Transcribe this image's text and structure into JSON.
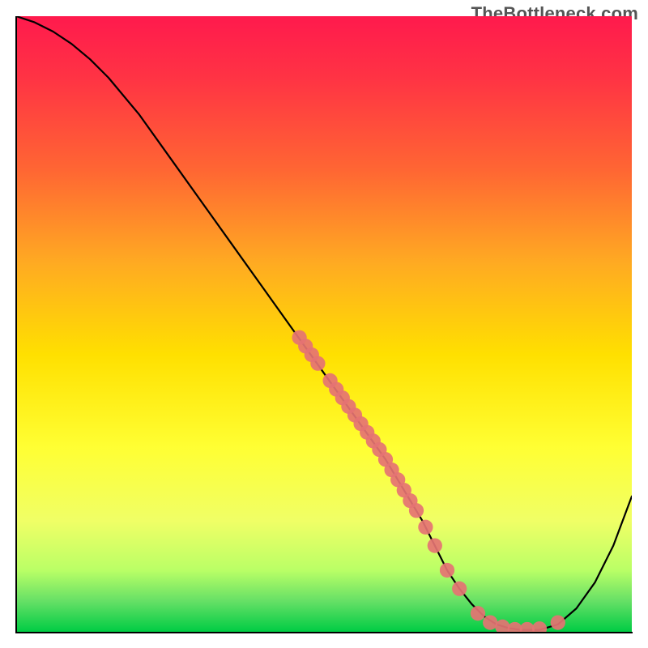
{
  "watermark": "TheBottleneck.com",
  "chart_data": {
    "type": "line",
    "title": "",
    "xlabel": "",
    "ylabel": "",
    "xlim": [
      0,
      100
    ],
    "ylim": [
      0,
      100
    ],
    "grid": false,
    "series": [
      {
        "name": "bottleneck-curve",
        "x": [
          0,
          3,
          6,
          9,
          12,
          15,
          20,
          25,
          30,
          35,
          40,
          45,
          50,
          55,
          60,
          63,
          66,
          68,
          70,
          72,
          74,
          76,
          78,
          80,
          82,
          85,
          88,
          91,
          94,
          97,
          100
        ],
        "y": [
          100,
          99,
          97.5,
          95.5,
          93,
          90,
          84,
          77,
          70,
          63,
          56,
          49,
          42,
          35,
          28,
          23,
          18,
          14,
          10,
          7,
          4.5,
          2.5,
          1.2,
          0.6,
          0.3,
          0.3,
          1.2,
          3.8,
          8,
          14,
          22
        ]
      }
    ],
    "scatter_points": [
      {
        "name": "marker-cluster",
        "x": 46,
        "y": 47.8,
        "r": 1.2
      },
      {
        "name": "marker-cluster",
        "x": 47,
        "y": 46.4,
        "r": 1.2
      },
      {
        "name": "marker-cluster",
        "x": 48,
        "y": 45.0,
        "r": 1.2
      },
      {
        "name": "marker-cluster",
        "x": 49,
        "y": 43.6,
        "r": 1.2
      },
      {
        "name": "marker-cluster",
        "x": 51,
        "y": 40.8,
        "r": 1.2
      },
      {
        "name": "marker-cluster",
        "x": 52,
        "y": 39.4,
        "r": 1.2
      },
      {
        "name": "marker-cluster",
        "x": 53,
        "y": 38.0,
        "r": 1.2
      },
      {
        "name": "marker-cluster",
        "x": 54,
        "y": 36.6,
        "r": 1.2
      },
      {
        "name": "marker-cluster",
        "x": 55,
        "y": 35.2,
        "r": 1.2
      },
      {
        "name": "marker-cluster",
        "x": 56,
        "y": 33.8,
        "r": 1.2
      },
      {
        "name": "marker-cluster",
        "x": 57,
        "y": 32.4,
        "r": 1.2
      },
      {
        "name": "marker-cluster",
        "x": 58,
        "y": 31.0,
        "r": 1.2
      },
      {
        "name": "marker-cluster",
        "x": 59,
        "y": 29.6,
        "r": 1.2
      },
      {
        "name": "marker-cluster",
        "x": 60,
        "y": 28.0,
        "r": 1.2
      },
      {
        "name": "marker-cluster",
        "x": 61,
        "y": 26.3,
        "r": 1.2
      },
      {
        "name": "marker-cluster",
        "x": 62,
        "y": 24.7,
        "r": 1.2
      },
      {
        "name": "marker-cluster",
        "x": 63,
        "y": 23.0,
        "r": 1.2
      },
      {
        "name": "marker-cluster",
        "x": 64,
        "y": 21.3,
        "r": 1.2
      },
      {
        "name": "marker-cluster",
        "x": 65,
        "y": 19.7,
        "r": 1.2
      },
      {
        "name": "marker-cluster",
        "x": 66.5,
        "y": 17.0,
        "r": 1.2
      },
      {
        "name": "marker-cluster",
        "x": 68,
        "y": 14.0,
        "r": 1.2
      },
      {
        "name": "marker-cluster",
        "x": 70,
        "y": 10.0,
        "r": 1.2
      },
      {
        "name": "marker-cluster",
        "x": 72,
        "y": 7.0,
        "r": 1.2
      },
      {
        "name": "marker-minimum",
        "x": 75,
        "y": 3.0,
        "r": 1.2
      },
      {
        "name": "marker-minimum",
        "x": 77,
        "y": 1.5,
        "r": 1.2
      },
      {
        "name": "marker-minimum",
        "x": 79,
        "y": 0.8,
        "r": 1.2
      },
      {
        "name": "marker-minimum",
        "x": 81,
        "y": 0.4,
        "r": 1.2
      },
      {
        "name": "marker-minimum",
        "x": 83,
        "y": 0.4,
        "r": 1.2
      },
      {
        "name": "marker-minimum",
        "x": 85,
        "y": 0.5,
        "r": 1.2
      },
      {
        "name": "marker-right",
        "x": 88,
        "y": 1.5,
        "r": 1.2
      }
    ]
  }
}
